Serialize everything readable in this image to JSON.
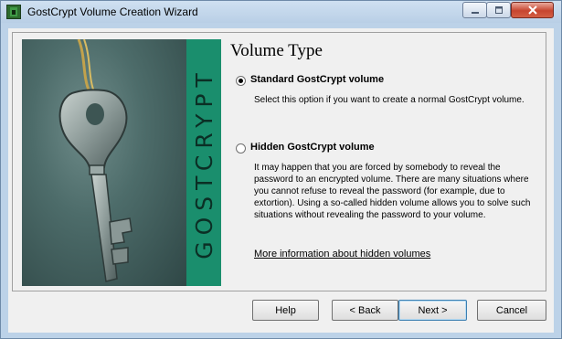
{
  "window": {
    "title": "GostCrypt Volume Creation Wizard"
  },
  "sidebar": {
    "brand_vertical_text": "GOSTCRYPT"
  },
  "main": {
    "heading": "Volume Type",
    "options": [
      {
        "label": "Standard GostCrypt volume",
        "selected": true,
        "description": "Select this option if you want to create a normal GostCrypt volume."
      },
      {
        "label": "Hidden GostCrypt volume",
        "selected": false,
        "description": "It may happen that you are forced by somebody to reveal the password to an encrypted volume. There are many situations where you cannot refuse to reveal the password (for example, due to extortion). Using a so-called hidden volume allows you to solve such situations without revealing the password to your volume."
      }
    ],
    "more_info_link": "More information about hidden volumes"
  },
  "footer": {
    "help_label": "Help",
    "back_label": "< Back",
    "next_label": "Next >",
    "cancel_label": "Cancel"
  },
  "colors": {
    "brand_stripe": "#1a8e6d",
    "title_bar": "#bcd2e8",
    "close_button": "#c7452f"
  }
}
